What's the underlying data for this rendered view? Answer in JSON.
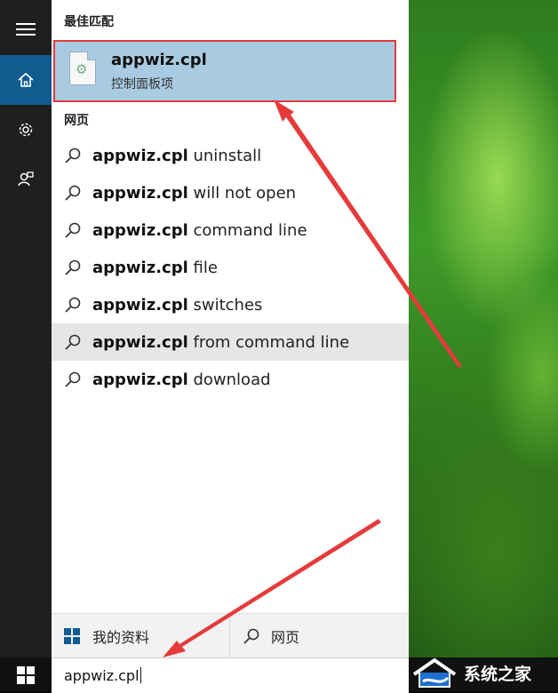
{
  "best_match": {
    "section_label": "最佳匹配",
    "title": "appwiz.cpl",
    "subtitle": "控制面板项"
  },
  "web_section_label": "网页",
  "suggestions": [
    {
      "bold": "appwiz.cpl",
      "rest": " uninstall"
    },
    {
      "bold": "appwiz.cpl",
      "rest": " will not open"
    },
    {
      "bold": "appwiz.cpl",
      "rest": " command line"
    },
    {
      "bold": "appwiz.cpl",
      "rest": " file"
    },
    {
      "bold": "appwiz.cpl",
      "rest": " switches"
    },
    {
      "bold": "appwiz.cpl",
      "rest": " from command line"
    },
    {
      "bold": "appwiz.cpl",
      "rest": " download"
    }
  ],
  "highlighted_suggestion": "appwiz.cpl from command line",
  "bottom": {
    "my_stuff_label": "我的资料",
    "web_label": "网页"
  },
  "search": {
    "value": "appwiz.cpl"
  },
  "watermark": {
    "text": "系统之家"
  },
  "colors": {
    "accent": "#0f5c8f",
    "selection": "#a9cbe2",
    "annotation_red": "#e53b3b"
  }
}
